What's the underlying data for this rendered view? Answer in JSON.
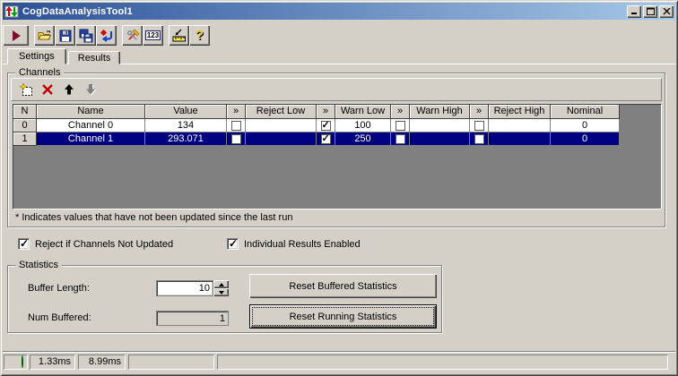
{
  "colors": {
    "titlebar_left": "#2c5198",
    "titlebar_right": "#a6c8e8",
    "selection": "#000080",
    "indicator_green": "#00d800",
    "run_red": "#7b1428"
  },
  "window": {
    "title": "CogDataAnalysisTool1"
  },
  "toolbar": {
    "numeric_button_label": "123",
    "help_button_label": "?",
    "buttons": [
      "run",
      "open",
      "save",
      "save-all",
      "revert",
      "tools",
      "numeric-display",
      "ruler",
      "help"
    ]
  },
  "tabs": [
    {
      "label": "Settings",
      "active": true
    },
    {
      "label": "Results",
      "active": false
    }
  ],
  "channels": {
    "group_label": "Channels",
    "note": "* Indicates values that have not been updated since the last run",
    "toolbar_buttons": [
      "new-channel",
      "delete-channel",
      "move-up",
      "move-down"
    ],
    "table": {
      "columns": [
        "N",
        "Name",
        "Value",
        "»",
        "Reject Low",
        "»",
        "Warn Low",
        "»",
        "Warn High",
        "»",
        "Reject High",
        "Nominal"
      ],
      "rows": [
        {
          "n": "0",
          "name": "Channel 0",
          "value": "134",
          "reject_low_enabled": false,
          "reject_low": "",
          "warn_low_enabled": true,
          "warn_low": "100",
          "warn_high_enabled": false,
          "warn_high": "",
          "reject_high_enabled": false,
          "reject_high": "",
          "nominal": "0",
          "selected": false
        },
        {
          "n": "1",
          "name": "Channel 1",
          "value": "293.071",
          "reject_low_enabled": false,
          "reject_low": "",
          "warn_low_enabled": true,
          "warn_low": "250",
          "warn_high_enabled": false,
          "warn_high": "",
          "reject_high_enabled": false,
          "reject_high": "",
          "nominal": "0",
          "selected": true
        }
      ]
    }
  },
  "options": {
    "reject_if_channels_not_updated": {
      "label": "Reject if Channels Not Updated",
      "checked": true
    },
    "individual_results_enabled": {
      "label": "Individual Results Enabled",
      "checked": true
    }
  },
  "statistics": {
    "group_label": "Statistics",
    "buffer_length_label": "Buffer Length:",
    "buffer_length_value": "10",
    "num_buffered_label": "Num Buffered:",
    "num_buffered_value": "1",
    "reset_buffered_label": "Reset Buffered Statistics",
    "reset_running_label": "Reset Running Statistics"
  },
  "status_bar": {
    "timing_1": "1.33ms",
    "timing_2": "8.99ms"
  }
}
